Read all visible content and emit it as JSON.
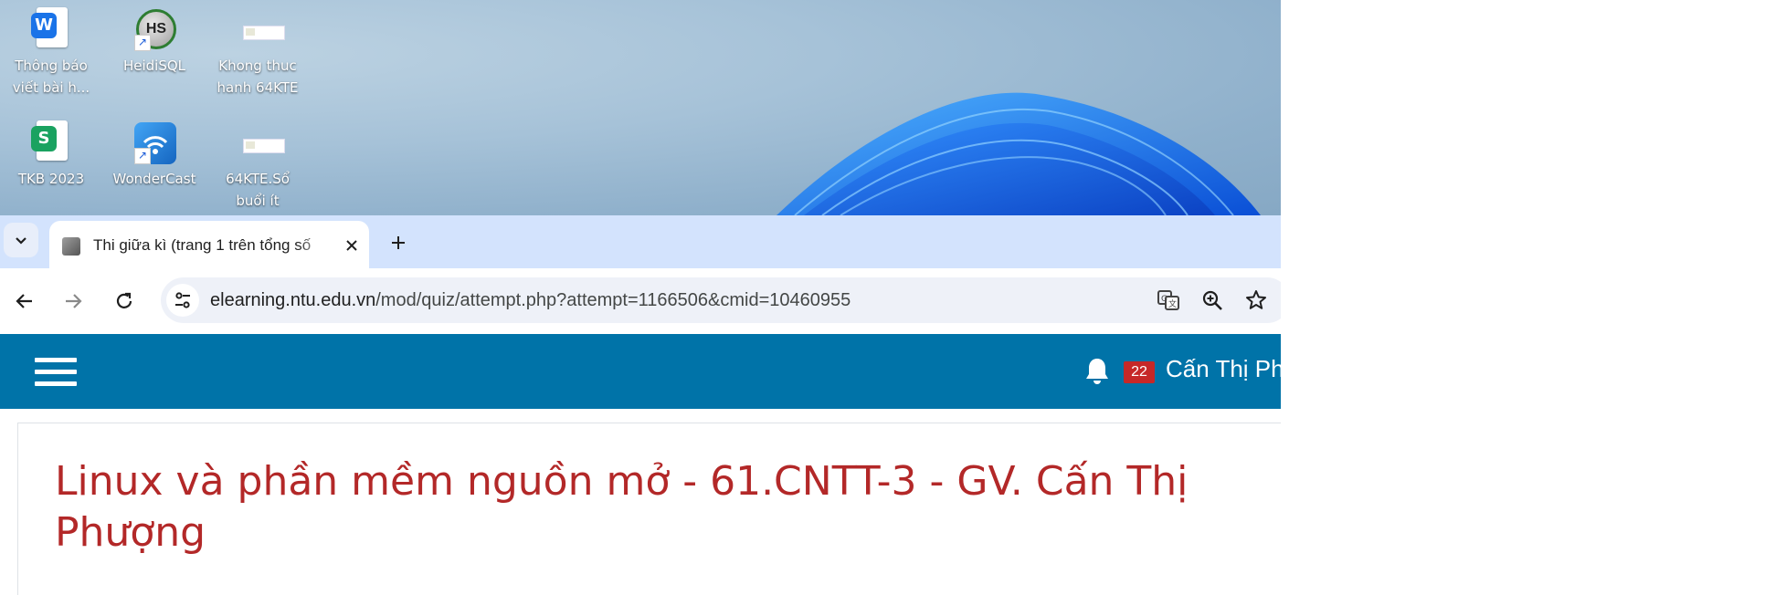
{
  "desktop": {
    "icons": [
      {
        "label": "Thông báo viết bài h...",
        "icon": "wps-writer-doc-icon",
        "color": "#1a73e8",
        "letter": "W"
      },
      {
        "label": "HeidiSQL",
        "icon": "heidisql-icon",
        "color": "#2e7d32",
        "letter": "HS"
      },
      {
        "label": "Khong thuc hanh 64KTE",
        "icon": "image-thumbnail-icon"
      },
      {
        "label": "TKB 2023",
        "icon": "wps-spreadsheet-doc-icon",
        "color": "#1aa260",
        "letter": "S"
      },
      {
        "label": "WonderCast",
        "icon": "wondercast-icon",
        "color": "#1e88e5"
      },
      {
        "label": "64KTE.Sổ buổi ít",
        "icon": "image-thumbnail-icon"
      }
    ]
  },
  "browser": {
    "tab": {
      "title": "Thi giữa kì (trang 1 trên tổng số",
      "close_icon": "close-icon"
    },
    "omnibox": {
      "host": "elearning.ntu.edu.vn",
      "path": "/mod/quiz/attempt.php?attempt=1166506&cmid=10460955"
    }
  },
  "site_header": {
    "notification_count": "22",
    "user_name": "Cấn Thị Phượng",
    "brand_color": "#0073a8"
  },
  "page": {
    "course_title": "Linux và phần mềm nguồn mở - 61.CNTT-3 - GV. Cấn Thị Phượng",
    "title_color": "#b32828"
  }
}
